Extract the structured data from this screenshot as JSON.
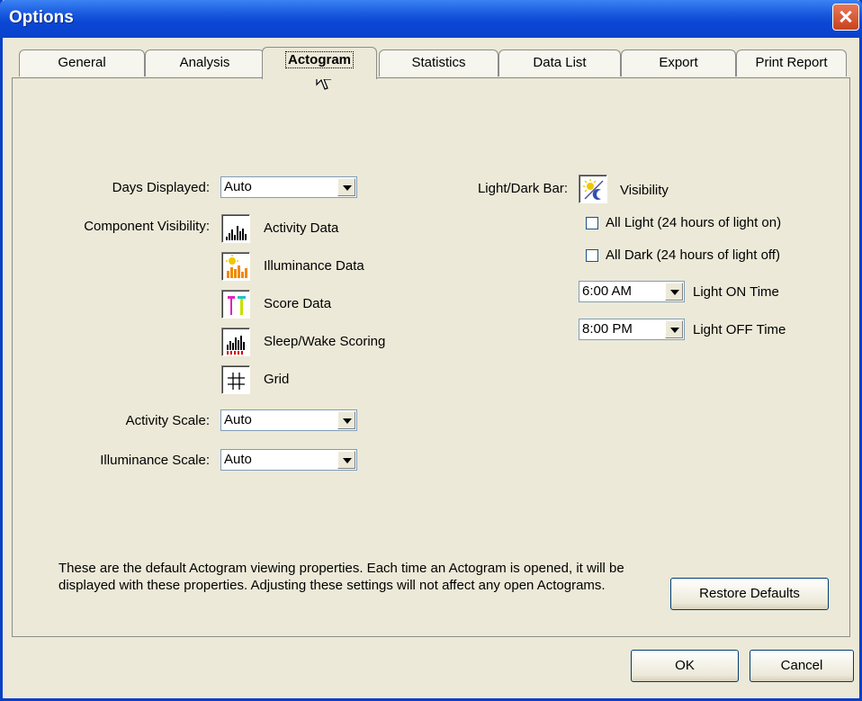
{
  "window": {
    "title": "Options"
  },
  "tabs": [
    {
      "label": "General"
    },
    {
      "label": "Analysis"
    },
    {
      "label": "Actogram"
    },
    {
      "label": "Statistics"
    },
    {
      "label": "Data List"
    },
    {
      "label": "Export"
    },
    {
      "label": "Print Report"
    }
  ],
  "active_tab": "Actogram",
  "left": {
    "days_displayed_label": "Days Displayed:",
    "days_displayed_value": "Auto",
    "component_visibility_label": "Component Visibility:",
    "components": [
      {
        "label": "Activity Data",
        "icon": "activity-data-icon"
      },
      {
        "label": "Illuminance Data",
        "icon": "illuminance-data-icon"
      },
      {
        "label": "Score Data",
        "icon": "score-data-icon"
      },
      {
        "label": "Sleep/Wake Scoring",
        "icon": "sleep-wake-scoring-icon"
      },
      {
        "label": "Grid",
        "icon": "grid-icon"
      }
    ],
    "activity_scale_label": "Activity Scale:",
    "activity_scale_value": "Auto",
    "illuminance_scale_label": "Illuminance Scale:",
    "illuminance_scale_value": "Auto"
  },
  "right": {
    "light_dark_bar_label": "Light/Dark Bar:",
    "visibility_label": "Visibility",
    "all_light_label": "All Light (24 hours of light on)",
    "all_light_checked": false,
    "all_dark_label": "All Dark (24 hours of light off)",
    "all_dark_checked": false,
    "light_on_value": "6:00 AM",
    "light_on_label": "Light ON Time",
    "light_off_value": "8:00 PM",
    "light_off_label": "Light OFF Time"
  },
  "note": "These are the default Actogram viewing properties. Each time an Actogram is opened, it will be displayed with these properties. Adjusting these settings will not affect any open Actograms.",
  "buttons": {
    "restore_defaults": "Restore Defaults",
    "ok": "OK",
    "cancel": "Cancel"
  },
  "colors": {
    "titlebar": "#0a42cc",
    "dialog_bg": "#ece9d8",
    "close_button": "#c9421c"
  }
}
